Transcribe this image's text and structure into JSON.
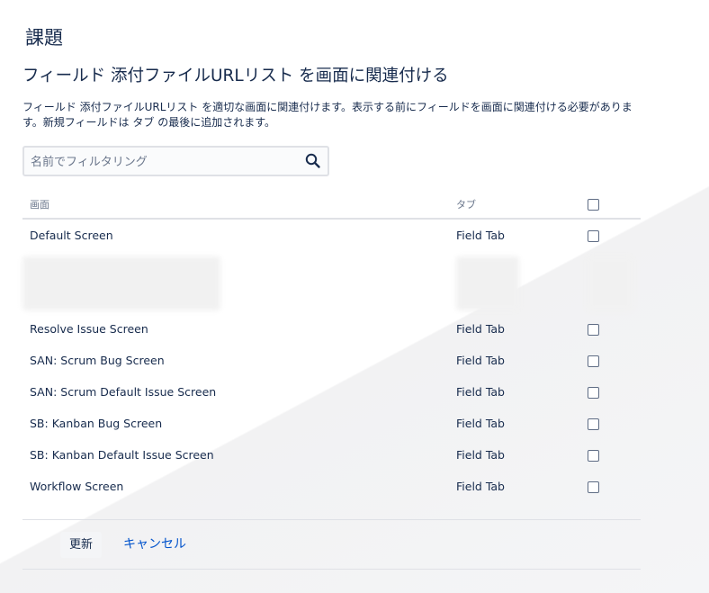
{
  "header": {
    "section_title": "課題"
  },
  "page": {
    "title": "フィールド 添付ファイルURLリスト を画面に関連付ける",
    "description": "フィールド 添付ファイルURLリスト を適切な画面に関連付けます。表示する前にフィールドを画面に関連付ける必要があります。新規フィールドは タブ の最後に追加されます。"
  },
  "search": {
    "placeholder": "名前でフィルタリング",
    "value": ""
  },
  "table": {
    "columns": {
      "screen": "画面",
      "tab": "タブ"
    },
    "rows_top": [
      {
        "screen": "Default Screen",
        "tab": "Field Tab"
      }
    ],
    "rows": [
      {
        "screen": "Resolve Issue Screen",
        "tab": "Field Tab"
      },
      {
        "screen": "SAN: Scrum Bug Screen",
        "tab": "Field Tab"
      },
      {
        "screen": "SAN: Scrum Default Issue Screen",
        "tab": "Field Tab"
      },
      {
        "screen": "SB: Kanban Bug Screen",
        "tab": "Field Tab"
      },
      {
        "screen": "SB: Kanban Default Issue Screen",
        "tab": "Field Tab"
      },
      {
        "screen": "Workflow Screen",
        "tab": "Field Tab"
      }
    ]
  },
  "actions": {
    "update_label": "更新",
    "cancel_label": "キャンセル"
  },
  "colors": {
    "link": "#0052cc",
    "text": "#172b4d",
    "muted": "#6b778c",
    "border": "#dfe1e6"
  }
}
